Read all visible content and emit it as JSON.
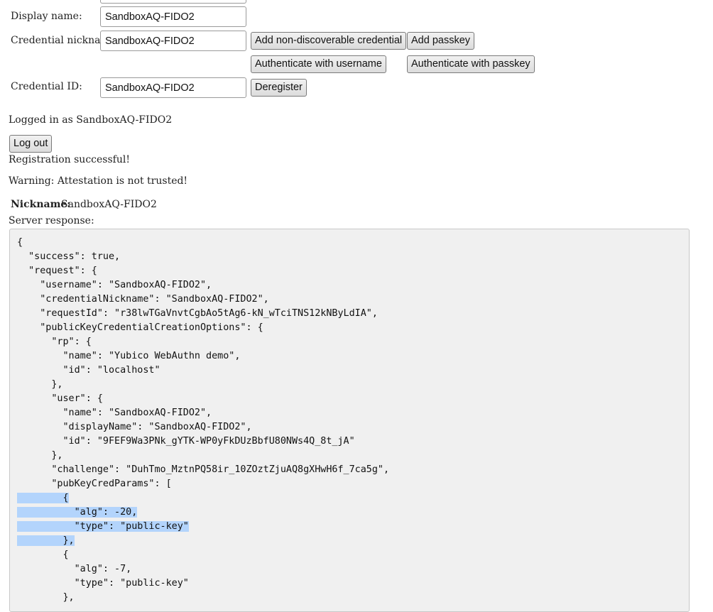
{
  "form": {
    "display_name_label": "Display name:",
    "display_name_value": "SandboxAQ-FIDO2",
    "credential_nickname_label": "Credential nickname:",
    "credential_nickname_value": "SandboxAQ-FIDO2",
    "credential_id_label": "Credential ID:",
    "credential_id_value": "SandboxAQ-FIDO2"
  },
  "buttons": {
    "add_non_discoverable": "Add non-discoverable credential",
    "add_passkey": "Add passkey",
    "auth_username": "Authenticate with username",
    "auth_passkey": "Authenticate with passkey",
    "deregister": "Deregister",
    "log_out": "Log out"
  },
  "status": {
    "logged_in": "Logged in as SandboxAQ-FIDO2",
    "registration": "Registration successful!",
    "warning": "Warning: Attestation is not trusted!",
    "nickname_label": "Nickname:",
    "nickname_value": "SandboxAQ-FIDO2",
    "server_response_label": "Server response:"
  },
  "response_lines": [
    "{",
    "  \"success\": true,",
    "  \"request\": {",
    "    \"username\": \"SandboxAQ-FIDO2\",",
    "    \"credentialNickname\": \"SandboxAQ-FIDO2\",",
    "    \"requestId\": \"r38lwTGaVnvtCgbAo5tAg6-kN_wTciTNS12kNByLdIA\",",
    "    \"publicKeyCredentialCreationOptions\": {",
    "      \"rp\": {",
    "        \"name\": \"Yubico WebAuthn demo\",",
    "        \"id\": \"localhost\"",
    "      },",
    "      \"user\": {",
    "        \"name\": \"SandboxAQ-FIDO2\",",
    "        \"displayName\": \"SandboxAQ-FIDO2\",",
    "        \"id\": \"9FEF9Wa3PNk_gYTK-WP0yFkDUzBbfU80NWs4Q_8t_jA\"",
    "      },",
    "      \"challenge\": \"DuhTmo_MztnPQ58ir_10ZOztZjuAQ8gXHwH6f_7ca5g\",",
    "      \"pubKeyCredParams\": [",
    "        {",
    "          \"alg\": -20,",
    "          \"type\": \"public-key\"",
    "        },",
    "        {",
    "          \"alg\": -7,",
    "          \"type\": \"public-key\"",
    "        },"
  ],
  "selection_color": "#b3d4fc"
}
